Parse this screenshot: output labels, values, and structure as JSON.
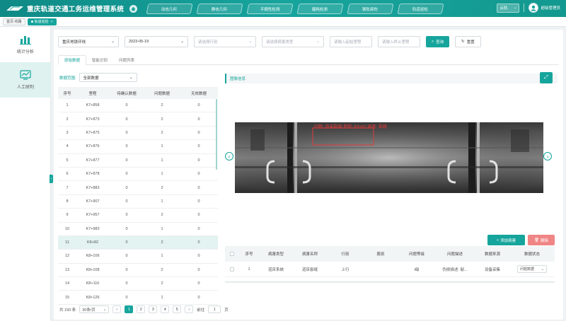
{
  "header": {
    "title": "重庆轨道交通工务运维管理系统",
    "nav": [
      "动态几何",
      "静态几何",
      "平顺性检测",
      "磨耗检测",
      "钢轨探伤",
      "轨道巡检"
    ],
    "line_select": "云轨",
    "user_name": "超级管理员"
  },
  "page_tabs": [
    {
      "label": "首页-线路"
    },
    {
      "label": "轨道巡检"
    }
  ],
  "sidebar": [
    {
      "label": "统计分析",
      "icon": "bar-chart-icon"
    },
    {
      "label": "人工研判",
      "icon": "line-chart-icon"
    }
  ],
  "filters": {
    "line": "重庆地铁环线",
    "date": "2023-05-19",
    "direction_placeholder": "请选择行别",
    "defect_type_placeholder": "请选择病害类型",
    "start_mileage_placeholder": "请输入起始里程",
    "end_mileage_placeholder": "请输入终止里程",
    "search_label": "查询",
    "reset_label": "重置"
  },
  "subtabs": [
    "原始数据",
    "智能识别",
    "问题列表"
  ],
  "scope": {
    "label": "数据范围:",
    "value": "全部数据"
  },
  "mileage_table": {
    "columns": [
      "序号",
      "里程",
      "待确认数据",
      "问题数据",
      "无效数据"
    ],
    "rows": [
      [
        "1",
        "K7+858",
        "0",
        "2",
        "0"
      ],
      [
        "2",
        "K7+873",
        "0",
        "2",
        "0"
      ],
      [
        "3",
        "K7+875",
        "0",
        "2",
        "0"
      ],
      [
        "4",
        "K7+876",
        "0",
        "1",
        "0"
      ],
      [
        "5",
        "K7+877",
        "0",
        "1",
        "0"
      ],
      [
        "6",
        "K7+878",
        "0",
        "1",
        "0"
      ],
      [
        "7",
        "K7+883",
        "0",
        "2",
        "0"
      ],
      [
        "8",
        "K7+907",
        "0",
        "1",
        "0"
      ],
      [
        "9",
        "K7+957",
        "0",
        "2",
        "0"
      ],
      [
        "10",
        "K7+983",
        "0",
        "1",
        "0"
      ],
      [
        "11",
        "K8+82",
        "0",
        "2",
        "0"
      ],
      [
        "12",
        "K8+106",
        "0",
        "1",
        "0"
      ],
      [
        "13",
        "K8+108",
        "0",
        "2",
        "0"
      ],
      [
        "14",
        "K8+110",
        "0",
        "2",
        "0"
      ],
      [
        "15",
        "K8+126",
        "0",
        "1",
        "0"
      ]
    ],
    "selected_row": 10
  },
  "pager": {
    "total": "共 150 条",
    "page_size": "30条/页",
    "pages": [
      "1",
      "2",
      "3",
      "4",
      "5"
    ],
    "current": "1",
    "goto_label": "前往",
    "goto_value": "1",
    "page_unit": "页"
  },
  "image_panel": {
    "title": "图像信息",
    "annotation": "问题: 道床裂缝  里程: K8+82  病害: 裂缝"
  },
  "actions": {
    "add_label": "添加病害",
    "delete_label": "删除"
  },
  "defect_table": {
    "columns": [
      "序号",
      "病害类型",
      "病害名称",
      "行别",
      "股别",
      "问题等级",
      "问题描述",
      "数据来源",
      "数据状态"
    ],
    "rows": [
      [
        "1",
        "道床系统",
        "道床裂缝",
        "上行",
        "",
        "Ⅰ级",
        "伪损描述: 裂...",
        "设备采集",
        "问题数据"
      ]
    ]
  },
  "colors": {
    "accent": "#16a59c",
    "danger": "#f08585"
  }
}
